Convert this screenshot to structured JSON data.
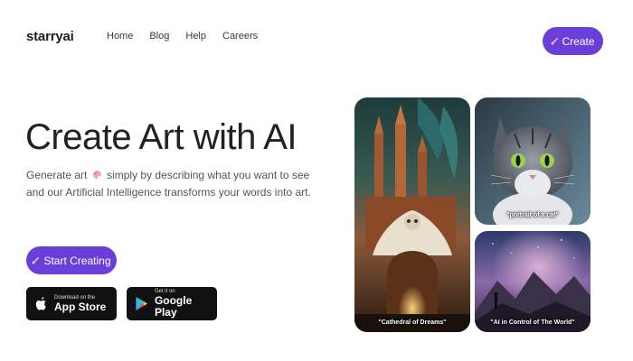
{
  "header": {
    "brand": "starryai",
    "nav": [
      "Home",
      "Blog",
      "Help",
      "Careers"
    ],
    "create_label": "Create"
  },
  "hero": {
    "title": "Create Art with AI",
    "subtitle_before_icon": "Generate art",
    "subtitle_after_icon": "simply by describing what you want to see and our Artificial Intelligence transforms your words into art.",
    "start_label": "Start Creating"
  },
  "stores": {
    "appstore": {
      "small": "Download on the",
      "big": "App Store"
    },
    "gplay": {
      "small": "Get it on",
      "big": "Google Play"
    }
  },
  "gallery": [
    {
      "caption": "\"Cathedral of Dreams\""
    },
    {
      "caption": "\"portrait of a cat\""
    },
    {
      "caption": "\"AI in Control of The World\""
    }
  ],
  "colors": {
    "accent": "#6a3fd9",
    "store_bg": "#111111"
  },
  "icons": {
    "brush": "paintbrush-icon",
    "palette": "palette-icon",
    "apple": "apple-icon",
    "play": "play-store-icon"
  }
}
